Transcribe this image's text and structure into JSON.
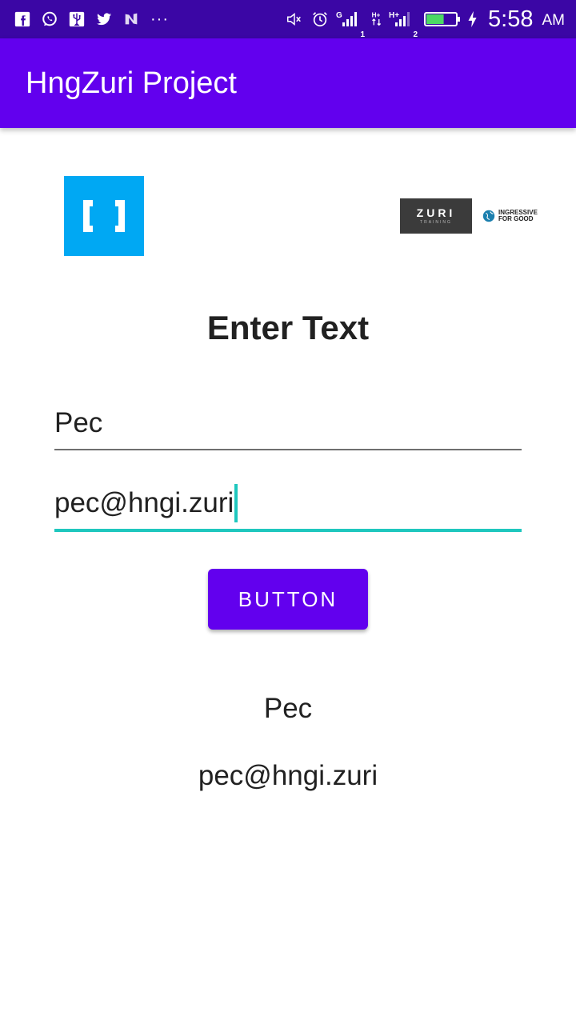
{
  "status_bar": {
    "time": "5:58",
    "ampm": "AM",
    "overflow": "···",
    "sim1_label": "G",
    "sim1_num": "1",
    "sim2_label": "H+",
    "sim2_num": "2",
    "icons": [
      "facebook-icon",
      "whatsapp-icon",
      "usb-icon",
      "twitter-icon",
      "n-app-icon",
      "mute-icon",
      "alarm-icon",
      "signal-icon",
      "battery-icon",
      "charging-icon"
    ],
    "battery_level_percent": 60,
    "colors": {
      "background": "#3b06a5",
      "battery_fill": "#4cd964"
    }
  },
  "app_bar": {
    "title": "HngZuri Project",
    "color": "#6200ee"
  },
  "logos": {
    "left_icon": "brackets-logo",
    "left_color": "#00a8f3",
    "zuri_word": "ZURI",
    "zuri_sub": "TRAINING",
    "ingressive_line1": "INGRESSIVE",
    "ingressive_line2": "FOR GOOD"
  },
  "main": {
    "heading": "Enter Text",
    "name_value": "Pec",
    "email_value": "pec@hngi.zuri",
    "button_label": "BUTTON",
    "output_name": "Pec",
    "output_email": "pec@hngi.zuri",
    "accent_color": "#1fc7be"
  }
}
